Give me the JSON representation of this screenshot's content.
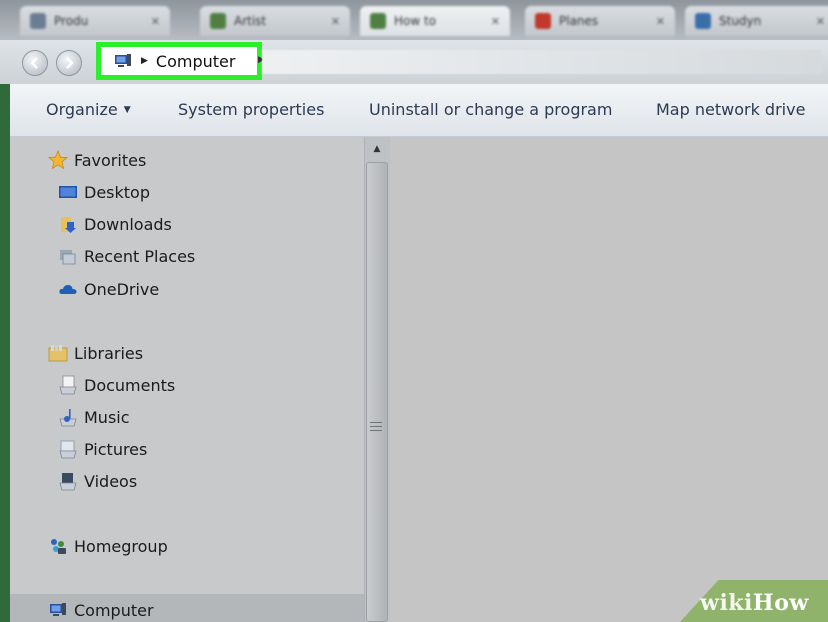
{
  "browser": {
    "tabs": [
      {
        "label": "Produ",
        "favicon_color": "#6a7d92"
      },
      {
        "label": "Artist",
        "favicon_color": "#4f7f43"
      },
      {
        "label": "How to",
        "favicon_color": "#4f7f43"
      },
      {
        "label": "Planes",
        "favicon_color": "#c0392b"
      },
      {
        "label": "Studyn",
        "favicon_color": "#3b6ea8"
      }
    ]
  },
  "address_bar": {
    "breadcrumb": "Computer"
  },
  "command_bar": {
    "organize": "Organize",
    "system_properties": "System properties",
    "uninstall": "Uninstall or change a program",
    "map_drive": "Map network drive"
  },
  "nav_pane": {
    "favorites": {
      "header": "Favorites",
      "items": [
        "Desktop",
        "Downloads",
        "Recent Places",
        "OneDrive"
      ]
    },
    "libraries": {
      "header": "Libraries",
      "items": [
        "Documents",
        "Music",
        "Pictures",
        "Videos"
      ]
    },
    "homegroup": "Homegroup",
    "computer": "Computer"
  },
  "watermark": {
    "part1": "wiki",
    "part2": "How"
  },
  "colors": {
    "highlight": "#2bef2b",
    "command_text": "#2b3b52"
  }
}
